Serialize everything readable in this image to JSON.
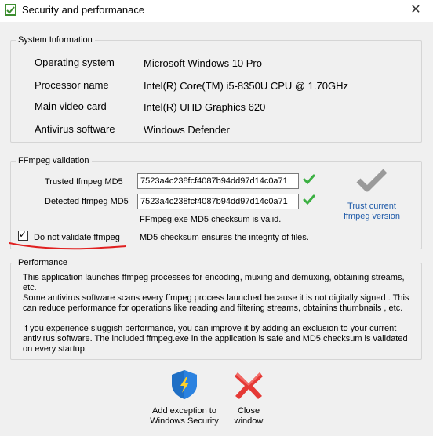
{
  "window": {
    "title": "Security and performanace",
    "close_glyph": "✕"
  },
  "system_info": {
    "legend": "System Information",
    "rows": [
      {
        "label": "Operating system",
        "value": "Microsoft Windows 10 Pro"
      },
      {
        "label": "Processor name",
        "value": "Intel(R) Core(TM) i5-8350U CPU @ 1.70GHz"
      },
      {
        "label": "Main video card",
        "value": "Intel(R) UHD Graphics 620"
      },
      {
        "label": "Antivirus software",
        "value": "Windows Defender"
      }
    ]
  },
  "ffmpeg": {
    "legend": "FFmpeg validation",
    "trusted_label": "Trusted ffmpeg MD5",
    "trusted_value": "7523a4c238fcf4087b94dd97d14c0a71",
    "detected_label": "Detected ffmpeg MD5",
    "detected_value": "7523a4c238fcf4087b94dd97d14c0a71",
    "status_text": "FFmpeg.exe MD5 checksum is valid.",
    "trust_button_label": "Trust current ffmpeg version",
    "checkbox_label": "Do not validate ffmpeg",
    "checkbox_checked": true,
    "integrity_text": "MD5 checksum ensures the integrity of files."
  },
  "performance": {
    "legend": "Performance",
    "paragraph1": "This application launches ffmpeg processes for encoding, muxing and demuxing, obtaining streams, etc.",
    "paragraph2": "Some antivirus software scans every ffmpeg process launched because it is not digitally signed . This can reduce performance for operations like reading and filtering streams, obtainins thumbnails , etc.",
    "paragraph3": "If you experience sluggish performance, you can improve it by adding an exclusion to your current antivirus software. The included ffmpeg.exe in the application is safe and MD5 checksum is validated on every startup."
  },
  "actions": {
    "add_exception_label": "Add exception to Windows Security",
    "close_label": "Close window"
  },
  "colors": {
    "accent_link": "#1e5aa8",
    "check_green": "#3cb043",
    "close_red": "#e53935",
    "shield_blue": "#1f6fc5",
    "annotation_red": "#e02020"
  }
}
